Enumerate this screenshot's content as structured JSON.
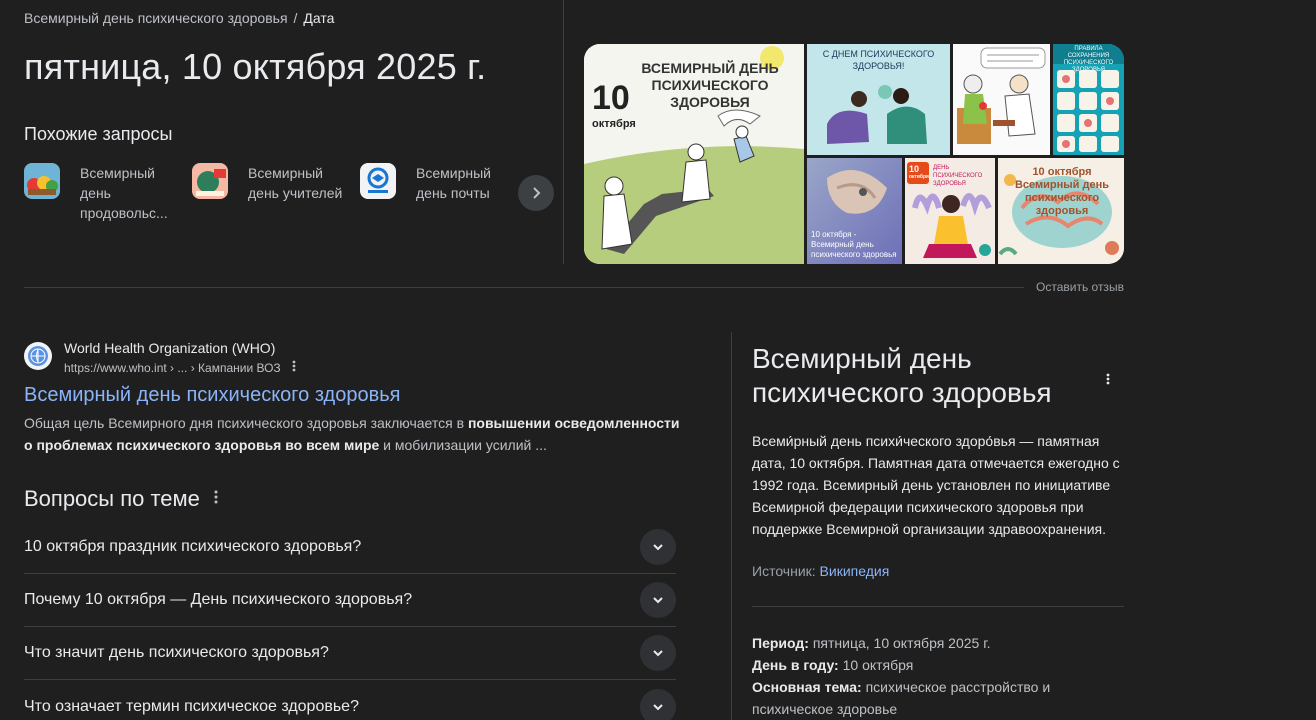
{
  "breadcrumb": {
    "parent": "Всемирный день психического здоровья",
    "separator": "/",
    "current": "Дата"
  },
  "answer": "пятница, 10 октября 2025 г.",
  "related": {
    "title": "Похожие запросы",
    "items": [
      {
        "label": "Всемирный день продовольс..."
      },
      {
        "label": "Всемирный день учителей"
      },
      {
        "label": "Всемирный день почты"
      }
    ]
  },
  "gallery": {
    "tile1": {
      "line1": "ВСЕМИРНЫЙ ДЕНЬ",
      "line2": "ПСИХИЧЕСКОГО",
      "line3": "ЗДОРОВЬЯ",
      "day": "10",
      "month": "октября"
    },
    "tile2": {
      "line1": "С ДНЕМ ПСИХИЧЕСКОГО",
      "line2": "ЗДОРОВЬЯ!"
    },
    "tile4": {
      "line1": "ПРАВИЛА",
      "line2": "СОХРАНЕНИЯ",
      "line3": "ПСИХИЧЕСКОГО ЗДОРОВЬЯ"
    },
    "tile5": {
      "line1": "10 октября -",
      "line2": "Всемирный день",
      "line3": "психического здоровья"
    },
    "tile6": {
      "day": "10",
      "month": "октября",
      "line1": "ДЕНЬ ПСИХИЧЕСКОГО",
      "line2": "ЗДОРОВЬЯ"
    },
    "tile7": {
      "line1": "10 октября",
      "line2": "Всемирный день",
      "line3": "психического здоровья"
    }
  },
  "feedback": "Оставить отзыв",
  "result": {
    "source_name": "World Health Organization (WHO)",
    "url": "https://www.who.int › ... › Кампании ВОЗ",
    "title": "Всемирный день психического здоровья",
    "snippet_start": "Общая цель Всемирного дня психического здоровья заключается в ",
    "snippet_bold": "повышении осведомленности о проблемах психического здоровья во всем мире",
    "snippet_end": " и мобилизации усилий ..."
  },
  "paa": {
    "title": "Вопросы по теме",
    "questions": [
      "10 октября праздник психического здоровья?",
      "Почему 10 октября — День психического здоровья?",
      "Что значит день психического здоровья?",
      "Что означает термин психическое здоровье?"
    ]
  },
  "knowledge_panel": {
    "title": "Всемирный день психического здоровья",
    "description": "Всеми́рный день психи́ческого здоро́вья — памятная дата, 10 октября. Памятная дата отмечается ежегодно с 1992 года. Всемирный день установлен по инициативе Всемирной федерации психического здоровья при поддержке Всемирной организации здравоохранения.",
    "source_label": "Источник:",
    "source_link": "Википедия",
    "facts": [
      {
        "label": "Период:",
        "value": "пятница, 10 октября 2025 г."
      },
      {
        "label": "День в году:",
        "value": "10 октября"
      },
      {
        "label": "Основная тема:",
        "value": "психическое расстройство и психическое здоровье"
      }
    ]
  },
  "icons": {
    "next": "chevron-right-icon",
    "expand": "chevron-down-icon",
    "more": "more-vert-icon",
    "source": "who-logo-icon"
  }
}
